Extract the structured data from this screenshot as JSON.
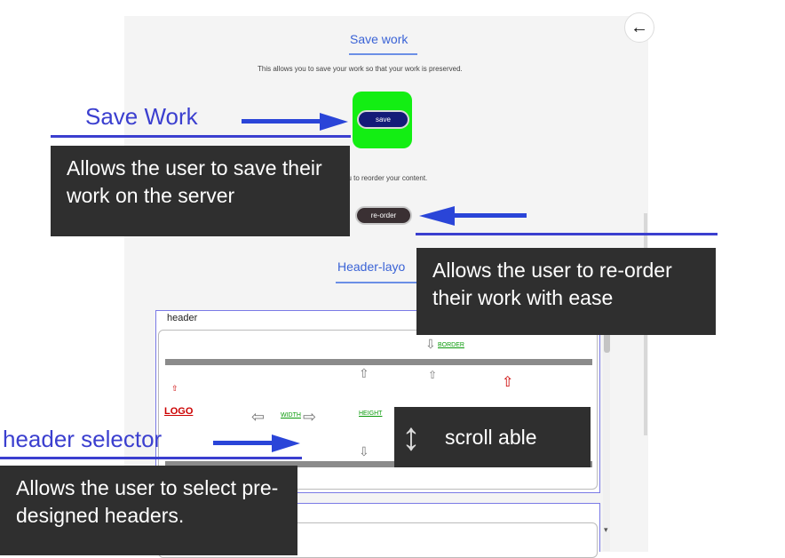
{
  "save_section": {
    "title": "Save work",
    "description": "This allows you to save your work so that your work is preserved.",
    "save_button_label": "save",
    "bg_color": "#13ee13"
  },
  "reorder_section": {
    "description_partial": "you to reorder your content.",
    "reorder_button_label": "re-order"
  },
  "header_section": {
    "title_partial": "Header-layo",
    "box_label": "header",
    "preview": {
      "logo_text": "LOGO",
      "width_text": "WIDTH",
      "height_text": "HEIGHT",
      "border_text": "BORDER"
    }
  },
  "annotations": {
    "save_label": "Save Work",
    "save_callout": "Allows the user to save their work on the server",
    "reorder_callout": "Allows the user to re-order their work with ease",
    "header_label": "header selector",
    "header_callout": "Allows the user to select pre-designed headers.",
    "scroll_callout": "scroll able"
  },
  "icons": {
    "back": "arrow-left-icon",
    "scroll": "vertical-double-arrow-icon"
  },
  "colors": {
    "annotation_blue": "#3b3fcf",
    "arrow_blue": "#2a45d8",
    "callout_bg": "#2f2f2f",
    "section_title_blue": "#3a63d6",
    "save_button_bg": "#141b78"
  }
}
